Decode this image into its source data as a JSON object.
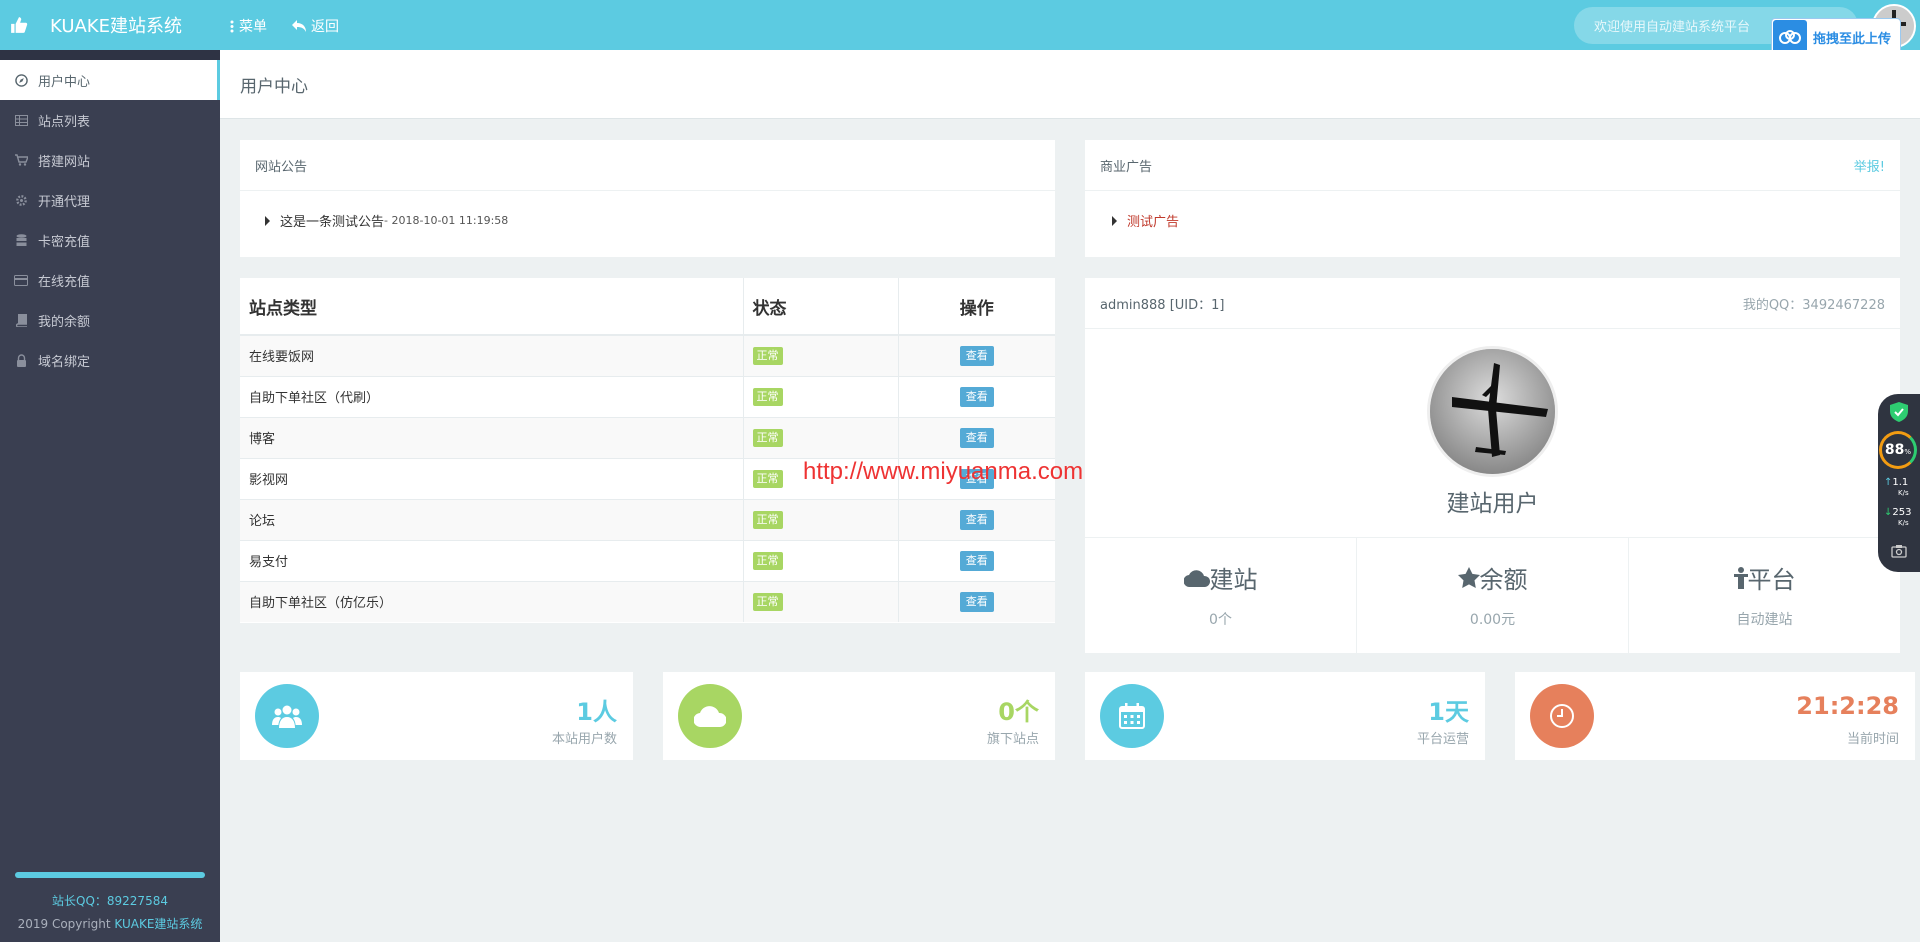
{
  "topbar": {
    "brand": "KUAKE建站系统",
    "menu_label": "菜单",
    "back_label": "返回",
    "welcome": "欢迎使用自动建站系统平台",
    "upload_label": "拖拽至此上传"
  },
  "sidebar": {
    "items": [
      {
        "label": "用户中心"
      },
      {
        "label": "站点列表"
      },
      {
        "label": "搭建网站"
      },
      {
        "label": "开通代理"
      },
      {
        "label": "卡密充值"
      },
      {
        "label": "在线充值"
      },
      {
        "label": "我的余额"
      },
      {
        "label": "域名绑定"
      }
    ],
    "footer_qq": "站长QQ：89227584",
    "footer_copy_prefix": "2019 Copyright ",
    "footer_copy_brand": "KUAKE建站系统"
  },
  "page": {
    "title": "用户中心"
  },
  "notice": {
    "title": "网站公告",
    "item_text": "这是一条测试公告",
    "item_date": " - 2018-10-01 11:19:58"
  },
  "ad": {
    "title": "商业广告",
    "report": "举报!",
    "item_text": "测试广告"
  },
  "site_table": {
    "headers": [
      "站点类型",
      "状态",
      "操作"
    ],
    "rows": [
      {
        "name": "在线要饭网",
        "status": "正常",
        "action": "查看"
      },
      {
        "name": "自助下单社区（代刷）",
        "status": "正常",
        "action": "查看"
      },
      {
        "name": "博客",
        "status": "正常",
        "action": "查看"
      },
      {
        "name": "影视网",
        "status": "正常",
        "action": "查看"
      },
      {
        "name": "论坛",
        "status": "正常",
        "action": "查看"
      },
      {
        "name": "易支付",
        "status": "正常",
        "action": "查看"
      },
      {
        "name": "自助下单社区（仿亿乐）",
        "status": "正常",
        "action": "查看"
      }
    ]
  },
  "user": {
    "name": "admin888",
    "uid": "[UID：1]",
    "qq": "我的QQ：3492467228",
    "role": "建站用户",
    "stats": [
      {
        "label": "建站",
        "value": "0个",
        "icon": "cloud-icon"
      },
      {
        "label": "余额",
        "value": "0.00元",
        "icon": "star-icon"
      },
      {
        "label": "平台",
        "value": "自动建站",
        "icon": "person-icon"
      }
    ]
  },
  "cards": [
    {
      "num": "1人",
      "caption": "本站用户数",
      "color": "#5ccbe1",
      "icon": "users-icon"
    },
    {
      "num": "0个",
      "caption": "旗下站点",
      "color": "#a8d663",
      "icon": "cloud-icon"
    },
    {
      "num": "1天",
      "caption": "平台运营",
      "color": "#5ccbe1",
      "icon": "calendar-icon"
    },
    {
      "num": "21:2:28",
      "caption": "当前时间",
      "color": "#e6805c",
      "icon": "clock-icon"
    }
  ],
  "watermark": "http://www.miyuanma.com",
  "widget": {
    "score": "88",
    "score_unit": "%",
    "up": "1.1",
    "down": "253",
    "unit": "K/s"
  },
  "colors": {
    "accent": "#5ccbe1",
    "sidebar": "#3a3f51",
    "green": "#a8d663",
    "orange": "#e6805c",
    "blue_btn": "#54aad6"
  }
}
